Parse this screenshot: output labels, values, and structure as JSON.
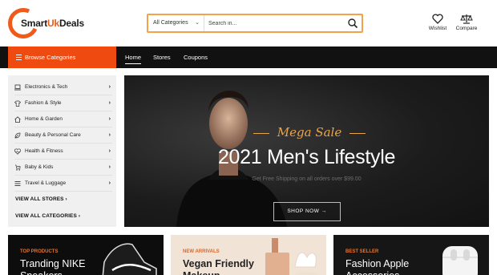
{
  "brand": {
    "name_prefix": "Smart",
    "name_mid": "Uk",
    "name_suffix": "Deals",
    "accent": "#ef4a10"
  },
  "search": {
    "category": "All Categories",
    "placeholder": "Search in..."
  },
  "header_actions": {
    "wishlist": "Wishlist",
    "compare": "Compare"
  },
  "nav": {
    "browse": "Browse Categories",
    "links": [
      "Home",
      "Stores",
      "Coupons"
    ],
    "active": "Home"
  },
  "sidebar": {
    "categories": [
      {
        "label": "Electronics & Tech",
        "icon": "laptop-icon"
      },
      {
        "label": "Fashion & Style",
        "icon": "shirt-icon"
      },
      {
        "label": "Home & Garden",
        "icon": "home-icon"
      },
      {
        "label": "Beauty & Personal Care",
        "icon": "leaf-icon"
      },
      {
        "label": "Health & Fitness",
        "icon": "heart-pulse-icon"
      },
      {
        "label": "Baby & Kids",
        "icon": "stroller-icon"
      },
      {
        "label": "Travel & Luggage",
        "icon": "list-icon"
      }
    ],
    "view_all_stores": "VIEW ALL STORES",
    "view_all_categories": "VIEW ALL CATEGORIES"
  },
  "hero": {
    "kicker": "Mega Sale",
    "title": "2021 Men's Lifestyle",
    "subtitle": "Get Free Shipping on all orders over $99.00",
    "button": "SHOP NOW"
  },
  "promos": [
    {
      "tag": "TOP PRODUCTS",
      "title": "Tranding NIKE Sneakers"
    },
    {
      "tag": "NEW ARRIVALS",
      "title": "Vegan Friendly Makeup"
    },
    {
      "tag": "BEST SELLER",
      "title": "Fashion Apple Accessories"
    }
  ]
}
